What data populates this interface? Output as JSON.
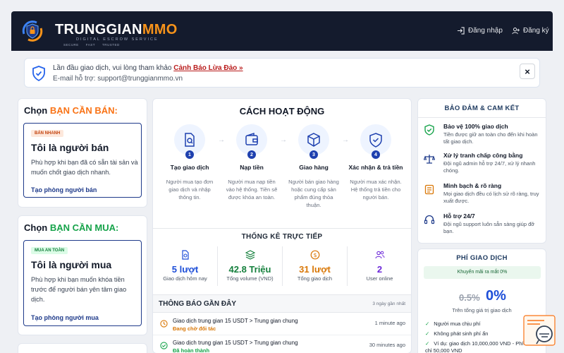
{
  "brand": {
    "name_part1": "TRUNGGIAN",
    "name_part2": "MMO",
    "tagline": "DIGITAL ESCROW SERVICE",
    "badges": [
      "SECURE",
      "FAST",
      "TRUSTED"
    ]
  },
  "header": {
    "login": "Đăng nhập",
    "register": "Đăng ký"
  },
  "notice": {
    "line1_prefix": "Lần đầu giao dịch, vui lòng tham khảo",
    "link": "Cảnh Báo Lừa Đảo »",
    "line2": "E-mail hỗ trợ: support@trunggianmmo.vn",
    "close": "×"
  },
  "sell": {
    "heading_prefix": "Chọn",
    "heading_hl": "BẠN CẦN BÁN:",
    "tag": "BÁN NHANH",
    "title": "Tôi là người bán",
    "desc": "Phù hợp khi bạn đã có sẵn tài sản và muốn chốt giao dịch nhanh.",
    "cta": "Tạo phòng người bán"
  },
  "buy": {
    "heading_prefix": "Chọn",
    "heading_hl": "BẠN CẦN MUA:",
    "tag": "MUA AN TOÀN",
    "title": "Tôi là người mua",
    "desc": "Phù hợp khi bạn muốn khóa tiền trước để người bán yên tâm giao dịch.",
    "cta": "Tạo phòng người mua"
  },
  "how": {
    "title": "CÁCH HOẠT ĐỘNG",
    "steps": [
      {
        "num": "1",
        "title": "Tạo giao dịch",
        "desc": "Người mua tạo đơn giao dịch và nhập thông tin."
      },
      {
        "num": "2",
        "title": "Nạp tiền",
        "desc": "Người mua nạp tiền vào hệ thống. Tiền sẽ được khóa an toàn."
      },
      {
        "num": "3",
        "title": "Giao hàng",
        "desc": "Người bán giao hàng hoặc cung cấp sản phẩm đúng thỏa thuận."
      },
      {
        "num": "4",
        "title": "Xác nhận & trả tiền",
        "desc": "Người mua xác nhận. Hệ thống trả tiền cho người bán."
      }
    ]
  },
  "stats": {
    "title": "THỐNG KÊ TRỰC TIẾP",
    "items": [
      {
        "value": "5 lượt",
        "label": "Giao dịch hôm nay",
        "color": "#1d4ed8"
      },
      {
        "value": "42.8 Triệu",
        "label": "Tổng volume (VND)",
        "color": "#15803d"
      },
      {
        "value": "31 lượt",
        "label": "Tổng giao dịch",
        "color": "#d97706"
      },
      {
        "value": "2",
        "label": "User online",
        "color": "#6d28d9"
      }
    ]
  },
  "notifications": {
    "title": "THÔNG BÁO GẦN ĐÂY",
    "meta": "3 ngày gần nhất",
    "items": [
      {
        "text": "Giao dịch trung gian 15 USDT > Trung gian chung",
        "status": "Đang chờ đối tác",
        "time": "1 minute ago",
        "status_color": "#d97706"
      },
      {
        "text": "Giao dịch trung gian 15 USDT > Trung gian chung",
        "status": "Đã hoàn thành",
        "time": "30 minutes ago",
        "status_color": "#16a34a"
      }
    ]
  },
  "guarantee": {
    "title": "BẢO ĐẢM & CAM KẾT",
    "items": [
      {
        "title": "Bảo vệ 100% giao dịch",
        "desc": "Tiền được giữ an toàn cho đến khi hoàn tất giao dịch."
      },
      {
        "title": "Xử lý tranh chấp công bằng",
        "desc": "Đội ngũ admin hỗ trợ 24/7, xử lý nhanh chóng."
      },
      {
        "title": "Minh bạch & rõ ràng",
        "desc": "Mọi giao dịch đều có lịch sử rõ ràng, truy xuất được."
      },
      {
        "title": "Hỗ trợ 24/7",
        "desc": "Đội ngũ support luôn sẵn sàng giúp đỡ bạn."
      }
    ]
  },
  "fee": {
    "title": "PHÍ GIAO DỊCH",
    "promo": "Khuyến mãi ra mắt 0%",
    "old": "0.5%",
    "new": "0%",
    "note": "Trên tổng giá trị giao dịch",
    "items": [
      "Người mua chịu phí",
      "Không phát sinh phí ẩn",
      "Ví dụ: giao dịch 10,000,000 VND - Phí chỉ 50,000 VND"
    ]
  },
  "colors": {
    "header_bg": "#141b2d",
    "accent_orange": "#f7931a",
    "primary": "#1e3a8a"
  }
}
